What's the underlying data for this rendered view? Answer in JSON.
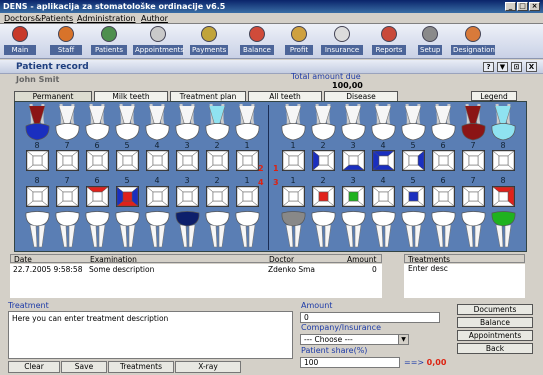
{
  "app": {
    "title": "DENS - aplikacija za stomatološke ordinacije v6.5",
    "window_controls": [
      "_",
      "□",
      "×"
    ]
  },
  "menu": [
    "Doctors&Patients",
    "Administration",
    "Author"
  ],
  "toolbar": [
    {
      "label": "Main",
      "icon": "home-icon",
      "color": "#c83a2a"
    },
    {
      "label": "Staff",
      "icon": "staff-icon",
      "color": "#d8732a"
    },
    {
      "label": "Patients",
      "icon": "patients-icon",
      "color": "#4e8f4e"
    },
    {
      "label": "Appointments",
      "icon": "clock-icon",
      "color": "#c9c9c9"
    },
    {
      "label": "Payments",
      "icon": "payments-icon",
      "color": "#c1a43a"
    },
    {
      "label": "Balance",
      "icon": "balance-icon",
      "color": "#d04b3a"
    },
    {
      "label": "Profit",
      "icon": "profit-icon",
      "color": "#cfa13f"
    },
    {
      "label": "Insurance",
      "icon": "insurance-icon",
      "color": "#dcdcdc"
    },
    {
      "label": "Reports",
      "icon": "reports-icon",
      "color": "#c94a3a"
    },
    {
      "label": "Setup",
      "icon": "setup-icon",
      "color": "#8a8a8a"
    },
    {
      "label": "Designation",
      "icon": "designation-icon",
      "color": "#d87a3a"
    }
  ],
  "page": {
    "title": "Patient record",
    "header_buttons": [
      "?",
      "▼",
      "⊡",
      "X"
    ],
    "patient_name": "John Smit",
    "total_label": "Total amount due",
    "total_value": "100,00"
  },
  "tabs": [
    "Permanent",
    "Milk teeth",
    "Treatment plan",
    "All teeth",
    "Disease"
  ],
  "active_tab": "Permanent",
  "legend_button": "Legend",
  "quadrants": {
    "top_left": "2",
    "top_right": "1",
    "bottom_left": "4",
    "bottom_right": "3"
  },
  "upper_left_numbers": [
    "8",
    "7",
    "6",
    "5",
    "4",
    "3",
    "2",
    "1"
  ],
  "upper_right_numbers": [
    "1",
    "2",
    "3",
    "4",
    "5",
    "6",
    "7",
    "8"
  ],
  "lower_left_numbers": [
    "8",
    "7",
    "6",
    "5",
    "4",
    "3",
    "2",
    "1"
  ],
  "lower_right_numbers": [
    "1",
    "2",
    "3",
    "4",
    "5",
    "6",
    "7",
    "8"
  ],
  "colors": {
    "chart_bg": "#5a7eb4",
    "decay_blue": "#1a2fbf",
    "red": "#e0211b",
    "green": "#1fb21f",
    "darkred": "#8b1515",
    "navy": "#0d1f6b",
    "cyan": "#8fe2f0"
  },
  "examinations": {
    "columns": [
      "Date",
      "Examination",
      "Doctor",
      "Amount"
    ],
    "rows": [
      [
        "22.7.2005 9:58:58",
        "Some description",
        "Zdenko Sma",
        "0"
      ]
    ]
  },
  "treatments": {
    "header": "Treatments",
    "rows": [
      "Enter desc"
    ]
  },
  "treatment_form": {
    "label": "Treatment",
    "text": "Here you can enter treatment description"
  },
  "amount": {
    "label": "Amount",
    "value": "0",
    "company_label": "Company/Insurance",
    "company_value": "--- Choose ---",
    "share_label": "Patient share(%)",
    "share_value": "100",
    "share_arrow": "==>",
    "share_result": "0,00"
  },
  "side_buttons": [
    "Documents",
    "Balance",
    "Appointments",
    "Back"
  ],
  "bottom_buttons": [
    "Clear",
    "Save",
    "Treatments",
    "X-ray"
  ]
}
